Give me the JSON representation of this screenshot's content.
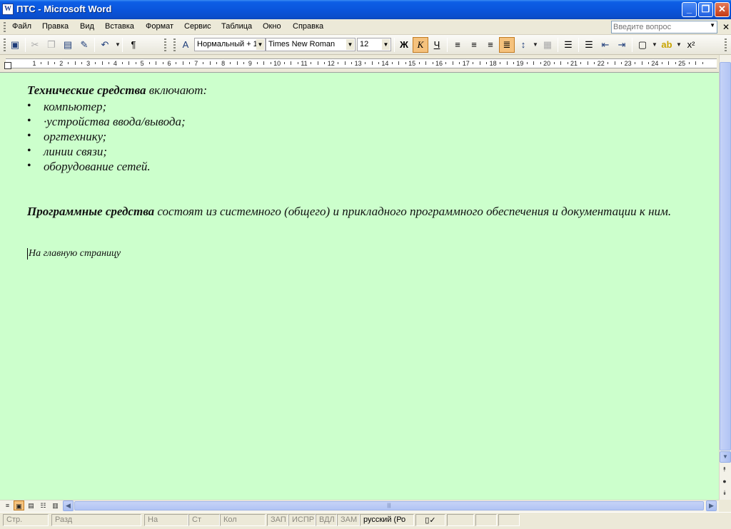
{
  "window": {
    "title": "ПТС - Microsoft Word",
    "app_icon": "W",
    "minimize": "_",
    "maximize": "❐",
    "close": "✕"
  },
  "menu": {
    "items": [
      "Файл",
      "Правка",
      "Вид",
      "Вставка",
      "Формат",
      "Сервис",
      "Таблица",
      "Окно",
      "Справка"
    ],
    "ask_placeholder": "Введите вопрос",
    "close_doc": "✕"
  },
  "toolbar": {
    "style": "Нормальный + 1",
    "font": "Times New Roman",
    "size": "12",
    "bold": "Ж",
    "italic": "К",
    "underline": "Ч",
    "paragraph_mark": "¶"
  },
  "ruler": {
    "numbers": [
      "1",
      "2",
      "3",
      "4",
      "5",
      "6",
      "7",
      "8",
      "9",
      "10",
      "11",
      "12",
      "13",
      "14",
      "15",
      "16",
      "17",
      "18",
      "19",
      "20",
      "21",
      "22",
      "23",
      "24",
      "25"
    ]
  },
  "document": {
    "heading1_bold": "Технические средства",
    "heading1_rest": " включают:",
    "bullets": [
      "компьютер;",
      "·устройства ввода/вывода;",
      "оргтехнику;",
      "линии связи;",
      "оборудование сетей."
    ],
    "para2_bold": "Программные средства",
    "para2_rest": " состоят из системного (общего) и прикладного программного обеспечения и документации к ним.",
    "link_text": "На главную страницу"
  },
  "statusbar": {
    "page": "Стр.",
    "section": "Разд",
    "at": "На",
    "line": "Ст",
    "col": "Кол",
    "rec": "ЗАП",
    "trk": "ИСПР",
    "ext": "ВДЛ",
    "ovr": "ЗАМ",
    "language": "русский (Ро"
  },
  "colors": {
    "document_background": "#CCFFCC",
    "titlebar": "#0A55DC",
    "active_button": "#F5C27D"
  }
}
